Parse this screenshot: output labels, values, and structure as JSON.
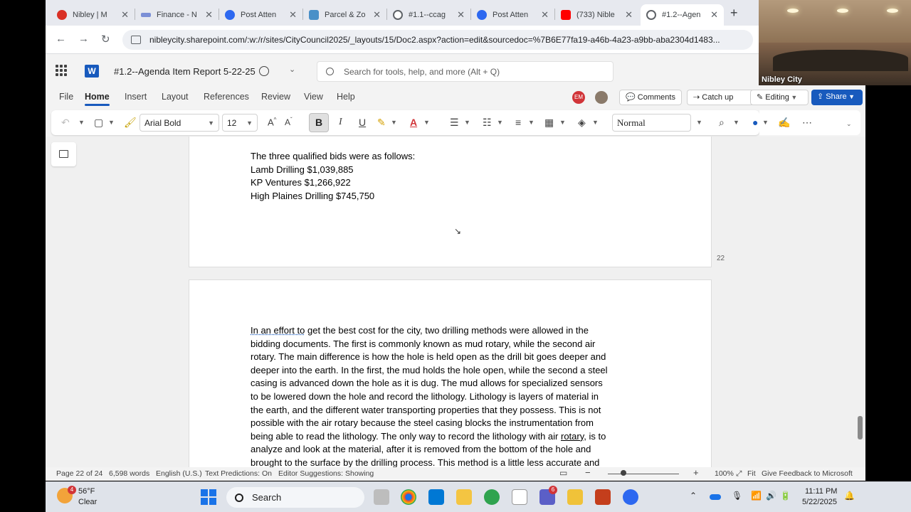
{
  "browser": {
    "tabs": [
      {
        "title": "Nibley | M",
        "fav_color": "#d93025"
      },
      {
        "title": "Finance - N",
        "fav_color": "#7b8fd6"
      },
      {
        "title": "Post Atten",
        "fav_color": "#2d68f0"
      },
      {
        "title": "Parcel & Zo",
        "fav_color": "#4a90c8"
      },
      {
        "title": "#1.1--ccag",
        "fav_color": "#5f6368"
      },
      {
        "title": "Post Atten",
        "fav_color": "#2d68f0"
      },
      {
        "title": "(733) Nible",
        "fav_color": "#ff0000"
      },
      {
        "title": "#1.2--Agen",
        "fav_color": "#5f6368"
      }
    ],
    "url": "nibleycity.sharepoint.com/:w:/r/sites/CityCouncil2025/_layouts/15/Doc2.aspx?action=edit&sourcedoc=%7B6E77fa19-a46b-4a23-a9bb-aba2304d1483..."
  },
  "word": {
    "title": "#1.2--Agenda Item Report 5-22-25",
    "search_placeholder": "Search for tools, help, and more (Alt + Q)",
    "ribbon_tabs": [
      "File",
      "Home",
      "Insert",
      "Layout",
      "References",
      "Review",
      "View",
      "Help"
    ],
    "avatar_initials": "EM",
    "comments_label": "Comments",
    "catchup_label": "Catch up",
    "editing_label": "Editing",
    "share_label": "Share",
    "font_name": "Arial Bold",
    "font_size": "12",
    "style_name": "Normal",
    "bold_label": "B",
    "italic_label": "I",
    "underline_label": "U"
  },
  "document": {
    "page1_lines": [
      "The three qualified bids were as follows:",
      "Lamb Drilling $1,039,885",
      "KP Ventures $1,266,922",
      "High Plaines Drilling $745,750"
    ],
    "page1_number": "22",
    "page2_squiggle": "In an effort to",
    "page2_lines": [
      " get the best cost for the city, two drilling methods were allowed in the",
      "bidding documents.  The first is commonly known as mud rotary, while the second air",
      "rotary.  The main difference is how the hole is held open as the drill bit goes deeper and",
      "deeper into the earth.  In the first, the mud holds the hole open, while the second a steel",
      "casing is advanced down the hole as it is dug.  The mud allows for specialized sensors",
      "to be lowered down the hole and record the lithology.  Lithology is layers of material in",
      "the earth, and the different water transporting properties that they possess.  This is not",
      "possible with the air rotary because the steel casing blocks the instrumentation from",
      "being able to read the lithology.  The only way to record the lithology with air ",
      "analyze and look at the material, after it is removed from the bottom of the hole and",
      "brought to the surface by the drilling process.  This method is a little less accurate and"
    ],
    "page2_line9_underlined": "rotary,",
    "page2_line9_tail": " is to"
  },
  "status": {
    "page": "Page 22 of 24",
    "words": "6,598 words",
    "language": "English (U.S.)",
    "predictions": "Text Predictions: On",
    "suggestions": "Editor Suggestions: Showing",
    "zoom": "100%",
    "fit": "Fit",
    "feedback": "Give Feedback to Microsoft"
  },
  "video": {
    "label": "Nibley City"
  },
  "taskbar": {
    "weather_temp": "56°F",
    "weather_desc": "Clear",
    "weather_badge": "4",
    "search_label": "Search",
    "time": "11:11 PM",
    "date": "5/22/2025",
    "teams_badge": "6"
  }
}
